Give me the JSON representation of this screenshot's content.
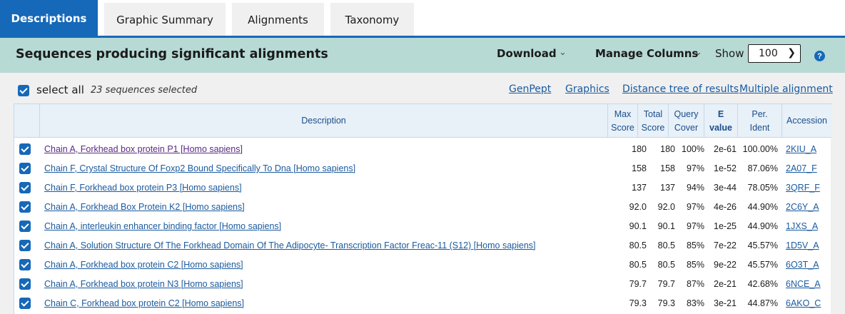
{
  "tabs": [
    {
      "label": "Descriptions",
      "active": true
    },
    {
      "label": "Graphic Summary"
    },
    {
      "label": "Alignments"
    },
    {
      "label": "Taxonomy"
    }
  ],
  "header": {
    "title": "Sequences producing significant alignments",
    "download": "Download",
    "manage_columns": "Manage Columns",
    "show_label": "Show",
    "show_value": "100",
    "help": "?"
  },
  "selection": {
    "select_all": "select all",
    "count": "23 sequences selected"
  },
  "links": {
    "genpept": "GenPept",
    "graphics": "Graphics",
    "distance_tree": "Distance tree of results",
    "multiple_alignment": "Multiple alignment"
  },
  "columns": {
    "description": "Description",
    "max_score_1": "Max",
    "max_score_2": "Score",
    "total_score_1": "Total",
    "total_score_2": "Score",
    "query_cover_1": "Query",
    "query_cover_2": "Cover",
    "evalue_1": "E",
    "evalue_2": "value",
    "per_ident_1": "Per.",
    "per_ident_2": "Ident",
    "accession": "Accession"
  },
  "rows": [
    {
      "description": "Chain A, Forkhead box protein P1 [Homo sapiens]",
      "max": "180",
      "total": "180",
      "cover": "100%",
      "evalue": "2e-61",
      "ident": "100.00%",
      "accession": "2KIU_A"
    },
    {
      "description": "Chain F, Crystal Structure Of Foxp2 Bound Specifically To Dna [Homo sapiens]",
      "max": "158",
      "total": "158",
      "cover": "97%",
      "evalue": "1e-52",
      "ident": "87.06%",
      "accession": "2A07_F"
    },
    {
      "description": "Chain F, Forkhead box protein P3 [Homo sapiens]",
      "max": "137",
      "total": "137",
      "cover": "94%",
      "evalue": "3e-44",
      "ident": "78.05%",
      "accession": "3QRF_F"
    },
    {
      "description": "Chain A, Forkhead Box Protein K2 [Homo sapiens]",
      "max": "92.0",
      "total": "92.0",
      "cover": "97%",
      "evalue": "4e-26",
      "ident": "44.90%",
      "accession": "2C6Y_A"
    },
    {
      "description": "Chain A, interleukin enhancer binding factor [Homo sapiens]",
      "max": "90.1",
      "total": "90.1",
      "cover": "97%",
      "evalue": "1e-25",
      "ident": "44.90%",
      "accession": "1JXS_A"
    },
    {
      "description": "Chain A, Solution Structure Of The Forkhead Domain Of The Adipocyte- Transcription Factor Freac-11 (S12) [Homo sapiens]",
      "max": "80.5",
      "total": "80.5",
      "cover": "85%",
      "evalue": "7e-22",
      "ident": "45.57%",
      "accession": "1D5V_A"
    },
    {
      "description": "Chain A, Forkhead box protein C2 [Homo sapiens]",
      "max": "80.5",
      "total": "80.5",
      "cover": "85%",
      "evalue": "9e-22",
      "ident": "45.57%",
      "accession": "6O3T_A"
    },
    {
      "description": "Chain A, Forkhead box protein N3 [Homo sapiens]",
      "max": "79.7",
      "total": "79.7",
      "cover": "87%",
      "evalue": "2e-21",
      "ident": "42.68%",
      "accession": "6NCE_A"
    },
    {
      "description": "Chain C, Forkhead box protein C2 [Homo sapiens]",
      "max": "79.3",
      "total": "79.3",
      "cover": "83%",
      "evalue": "3e-21",
      "ident": "44.87%",
      "accession": "6AKO_C"
    }
  ]
}
